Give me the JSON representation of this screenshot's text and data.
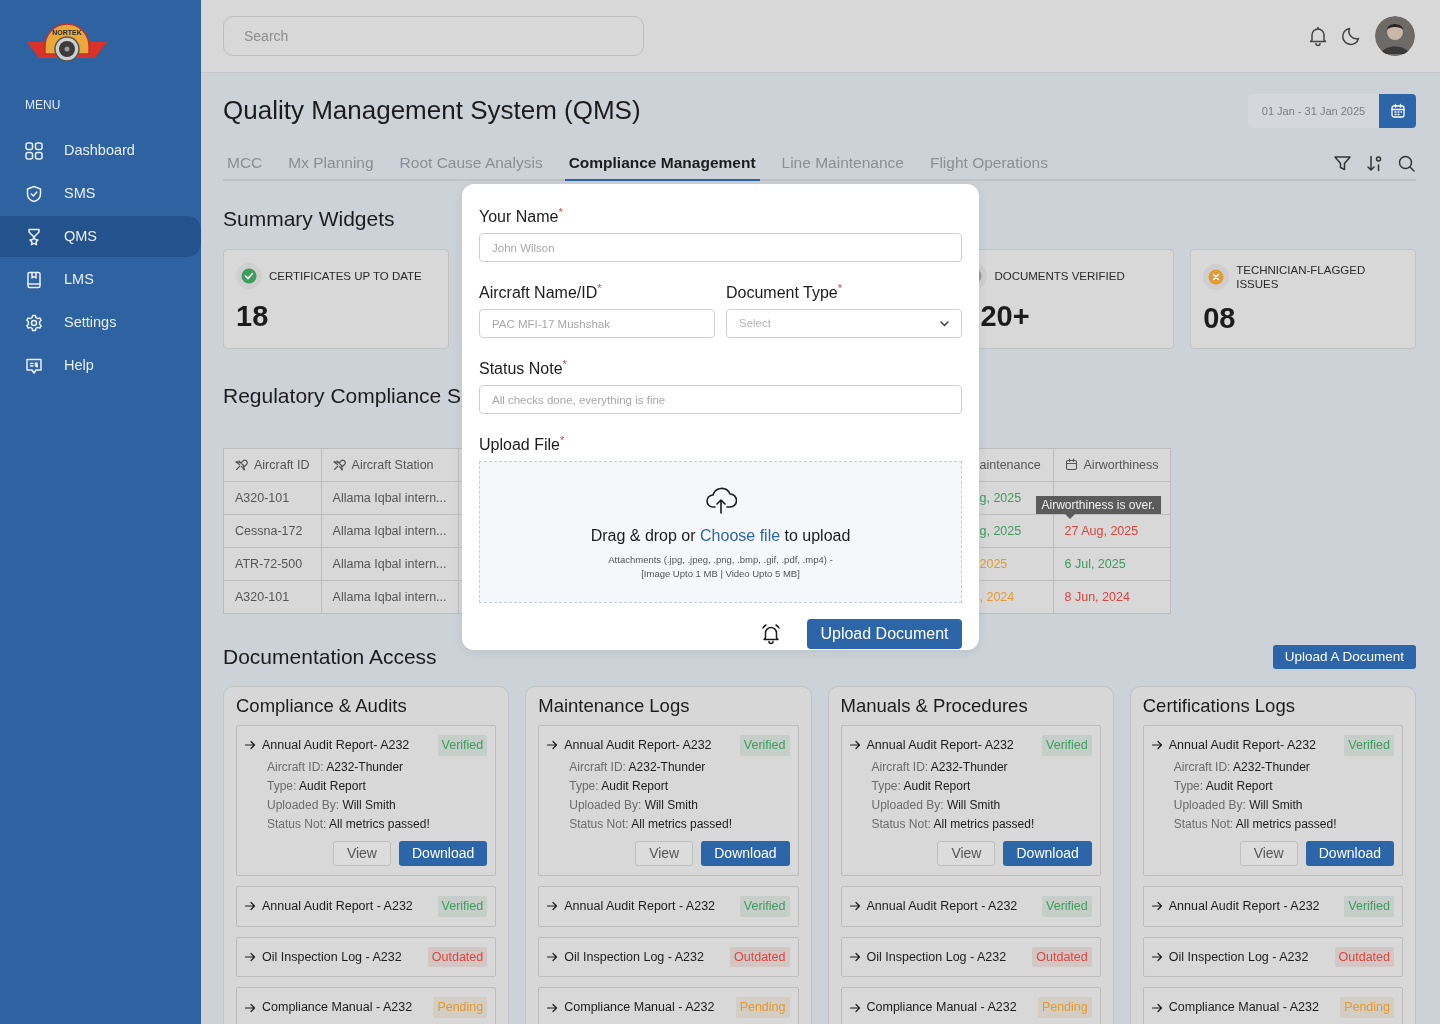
{
  "sidebar": {
    "logo_text": "NORTEK",
    "menu_label": "MENU",
    "items": [
      {
        "label": "Dashboard",
        "selected": false
      },
      {
        "label": "SMS",
        "selected": false
      },
      {
        "label": "QMS",
        "selected": true
      },
      {
        "label": "LMS",
        "selected": false
      },
      {
        "label": "Settings",
        "selected": false
      },
      {
        "label": "Help",
        "selected": false
      }
    ]
  },
  "topbar": {
    "search": {
      "placeholder": "Search"
    }
  },
  "page": {
    "title": "Quality Management System (QMS)",
    "date_range": "01 Jan - 31 Jan 2025"
  },
  "tabs": [
    {
      "label": "MCC",
      "selected": false
    },
    {
      "label": "Mx Planning",
      "selected": false
    },
    {
      "label": "Root Cause Analysis",
      "selected": false
    },
    {
      "label": "Compliance Management",
      "selected": true
    },
    {
      "label": "Line Maintenance",
      "selected": false
    },
    {
      "label": "Flight Operations",
      "selected": false
    }
  ],
  "summary": {
    "title": "Summary Widgets",
    "widgets": [
      {
        "kind": "positive",
        "label": "CERTIFICATES UP TO DATE",
        "value": "18",
        "color": "#3e9b5e"
      },
      {
        "kind": "neutral",
        "label": "DOCUMENTS VERIFIED",
        "value": "20+"
      },
      {
        "kind": "flagged",
        "label": "TECHNICIAN-FLAGGED ISSUES",
        "value": "08",
        "color": "#e39a33"
      }
    ]
  },
  "table": {
    "title": "Regulatory Compliance S",
    "columns": [
      "Aircraft ID",
      "Aircraft Station",
      "aintenance",
      "Airworthiness"
    ],
    "rows": [
      {
        "cells": [
          {
            "text": "A320-101"
          },
          {
            "text": "Allama Iqbal intern..."
          },
          {
            "text": "g, 2025",
            "color": "#3e9b5e"
          },
          {
            "tooltip": "Airworthiness is over."
          }
        ]
      },
      {
        "cells": [
          {
            "text": "Cessna-172"
          },
          {
            "text": "Allama Iqbal intern..."
          },
          {
            "text": "g, 2025",
            "color": "#3e9b5e"
          },
          {
            "text": "27 Aug, 2025",
            "color": "#d9453f"
          }
        ]
      },
      {
        "cells": [
          {
            "text": "ATR-72-500"
          },
          {
            "text": "Allama Iqbal intern..."
          },
          {
            "text": "2025",
            "color": "#e39a33"
          },
          {
            "text": "6 Jul, 2025",
            "color": "#3e9b5e"
          }
        ]
      },
      {
        "cells": [
          {
            "text": "A320-101"
          },
          {
            "text": "Allama Iqbal intern..."
          },
          {
            "text": ", 2024",
            "color": "#e39a33"
          },
          {
            "text": "8 Jun, 2024",
            "color": "#d9453f"
          }
        ]
      }
    ]
  },
  "docs": {
    "title": "Documentation Access",
    "upload_button": "Upload A Document",
    "groups": [
      {
        "title": "Compliance & Audits",
        "items": [
          {
            "title": "Annual Audit Report- A232",
            "status": "Verified",
            "color": "#3e9b5e",
            "expanded": true,
            "details": [
              {
                "label": "Aircraft ID:",
                "value": "A232-Thunder"
              },
              {
                "label": "Type:",
                "value": "Audit Report"
              },
              {
                "label": "Uploaded By:",
                "value": "Will Smith"
              },
              {
                "label": "Status Not:",
                "value": "All metrics passed!"
              }
            ],
            "actions": [
              "View",
              "Download"
            ]
          },
          {
            "title": "Annual Audit Report - A232",
            "status": "Verified",
            "color": "#3e9b5e",
            "expanded": false
          },
          {
            "title": "Oil Inspection Log - A232",
            "status": "Outdated",
            "color": "#d9453f",
            "expanded": false
          },
          {
            "title": "Compliance Manual - A232",
            "status": "Pending",
            "color": "#e39a33",
            "expanded": false
          }
        ]
      },
      {
        "title": "Maintenance Logs",
        "items": [
          {
            "title": "Annual Audit Report- A232",
            "status": "Verified",
            "color": "#3e9b5e",
            "expanded": true,
            "details": [
              {
                "label": "Aircraft ID:",
                "value": "A232-Thunder"
              },
              {
                "label": "Type:",
                "value": "Audit Report"
              },
              {
                "label": "Uploaded By:",
                "value": "Will Smith"
              },
              {
                "label": "Status Not:",
                "value": "All metrics passed!"
              }
            ],
            "actions": [
              "View",
              "Download"
            ]
          },
          {
            "title": "Annual Audit Report - A232",
            "status": "Verified",
            "color": "#3e9b5e",
            "expanded": false
          },
          {
            "title": "Oil Inspection Log - A232",
            "status": "Outdated",
            "color": "#d9453f",
            "expanded": false
          },
          {
            "title": "Compliance Manual - A232",
            "status": "Pending",
            "color": "#e39a33",
            "expanded": false
          }
        ]
      },
      {
        "title": "Manuals & Procedures",
        "items": [
          {
            "title": "Annual Audit Report- A232",
            "status": "Verified",
            "color": "#3e9b5e",
            "expanded": true,
            "details": [
              {
                "label": "Aircraft ID:",
                "value": "A232-Thunder"
              },
              {
                "label": "Type:",
                "value": "Audit Report"
              },
              {
                "label": "Uploaded By:",
                "value": "Will Smith"
              },
              {
                "label": "Status Not:",
                "value": "All metrics passed!"
              }
            ],
            "actions": [
              "View",
              "Download"
            ]
          },
          {
            "title": "Annual Audit Report - A232",
            "status": "Verified",
            "color": "#3e9b5e",
            "expanded": false
          },
          {
            "title": "Oil Inspection Log - A232",
            "status": "Outdated",
            "color": "#d9453f",
            "expanded": false
          },
          {
            "title": "Compliance Manual - A232",
            "status": "Pending",
            "color": "#e39a33",
            "expanded": false
          }
        ]
      },
      {
        "title": "Certifications Logs",
        "items": [
          {
            "title": "Annual Audit Report- A232",
            "status": "Verified",
            "color": "#3e9b5e",
            "expanded": true,
            "details": [
              {
                "label": "Aircraft ID:",
                "value": "A232-Thunder"
              },
              {
                "label": "Type:",
                "value": "Audit Report"
              },
              {
                "label": "Uploaded By:",
                "value": "Will Smith"
              },
              {
                "label": "Status Not:",
                "value": "All metrics passed!"
              }
            ],
            "actions": [
              "View",
              "Download"
            ]
          },
          {
            "title": "Annual Audit Report - A232",
            "status": "Verified",
            "color": "#3e9b5e",
            "expanded": false
          },
          {
            "title": "Oil Inspection Log - A232",
            "status": "Outdated",
            "color": "#d9453f",
            "expanded": false
          },
          {
            "title": "Compliance Manual - A232",
            "status": "Pending",
            "color": "#e39a33",
            "expanded": false
          }
        ]
      }
    ]
  },
  "upload_modal": {
    "fields": [
      {
        "kind": "text",
        "label": "Your Name",
        "mark": "*",
        "placeholder": "John Wilson"
      },
      {
        "kind": "text",
        "label": "Aircraft Name/ID",
        "mark": "*",
        "placeholder": "PAC MFI-17 Mushshak"
      },
      {
        "kind": "select",
        "label": "Document Type",
        "mark": "*",
        "placeholder": "Select"
      },
      {
        "kind": "text",
        "label": "Status Note",
        "mark": "*",
        "placeholder": "All checks done, everything is fine"
      },
      {
        "kind": "dropzone",
        "label": "Upload File",
        "mark": "*",
        "prompt_before": "Drag & drop or",
        "link": "Choose file",
        "prompt_after": "to upload",
        "hints": [
          "Attachments (.jpg, .jpeg, .png, .bmp, .gif, .pdf, .mp4) -",
          "[Image Upto 1 MB | Video Upto 5 MB]"
        ]
      }
    ],
    "submit": "Upload Document"
  }
}
